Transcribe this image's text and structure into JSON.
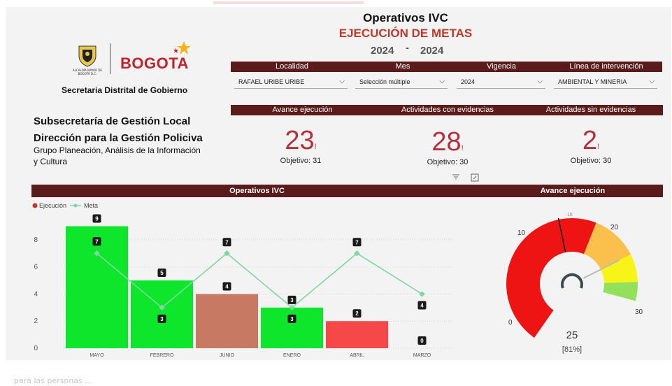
{
  "header": {
    "title": "Operativos IVC",
    "subtitle": "EJECUCIÓN DE METAS",
    "year_from": "2024",
    "year_sep": "-",
    "year_to": "2024"
  },
  "logo": {
    "crest_caption": "ALCALDÍA MAYOR DE BOGOTÁ D.C.",
    "brand": "BOGOTA",
    "entity": "Secretaria Distrital de Gobierno"
  },
  "org": {
    "line1": "Subsecretaría de Gestión Local",
    "line2": "Dirección para la Gestión Policiva",
    "line3": "Grupo Planeación, Análisis de la Información",
    "line4": "y Cultura"
  },
  "filters": [
    {
      "label": "Localidad",
      "value": "RAFAEL URIBE URIBE"
    },
    {
      "label": "Mes",
      "value": "Selección múltiple"
    },
    {
      "label": "Vigencia",
      "value": "2024"
    },
    {
      "label": "Línea de intervención",
      "value": "AMBIENTAL Y MINERIA"
    }
  ],
  "kpis": [
    {
      "label": "Avance ejecución",
      "value": "23",
      "flag": "!",
      "objective": "Objetivo: 31"
    },
    {
      "label": "Actividades con evidencias",
      "value": "28",
      "flag": "!",
      "objective": "Objetivo: 30"
    },
    {
      "label": "Actividades sin evidencias",
      "value": "2",
      "flag": "!",
      "objective": "Objetivo: 30"
    }
  ],
  "icons": {
    "filter": "filter-icon",
    "expand": "expand-icon",
    "chevron": "chevron-down-icon"
  },
  "bar_section": {
    "title": "Operativos IVC",
    "legend_exec": "Ejecución",
    "legend_meta": "Meta"
  },
  "gauge_section": {
    "title": "Avance ejecución",
    "value": "25",
    "percent": "[81%]",
    "label_min": "0",
    "label_10": "10",
    "label_target": "16",
    "label_20": "20",
    "label_max": "30"
  },
  "footer_blur": "para las personas ...",
  "colors": {
    "band": "#5b1b1b",
    "kpi": "#b5303b",
    "green": "#0ee62b",
    "salmon": "#c87963",
    "red_bar": "#f54848",
    "meta_line": "#7ed6a5"
  },
  "chart_data": [
    {
      "type": "bar",
      "title": "Operativos IVC",
      "categories": [
        "MAYO",
        "FEBRERO",
        "JUNIO",
        "ENERO",
        "ABRIL",
        "MARZO"
      ],
      "series": [
        {
          "name": "Ejecución",
          "values": [
            9,
            5,
            4,
            3,
            2,
            0
          ],
          "colors": [
            "#0ee62b",
            "#0ee62b",
            "#c87963",
            "#0ee62b",
            "#f54848",
            "#f54848"
          ]
        },
        {
          "name": "Meta",
          "type": "line",
          "values": [
            7,
            3,
            7,
            3,
            7,
            4
          ]
        }
      ],
      "yticks": [
        0,
        2,
        4,
        6,
        8
      ],
      "ylim": [
        0,
        9.8
      ],
      "grid": true,
      "legend": "top-left"
    },
    {
      "type": "gauge",
      "title": "Avance ejecución",
      "value": 25,
      "min": 0,
      "max": 30,
      "target": 16,
      "bands": [
        {
          "from": 0,
          "to": 20,
          "color": "#ef1414"
        },
        {
          "from": 20,
          "to": 25,
          "color": "#fbc04b"
        },
        {
          "from": 25,
          "to": 28,
          "color": "#f7f518"
        },
        {
          "from": 28,
          "to": 30,
          "color": "#93e05a"
        }
      ]
    }
  ]
}
